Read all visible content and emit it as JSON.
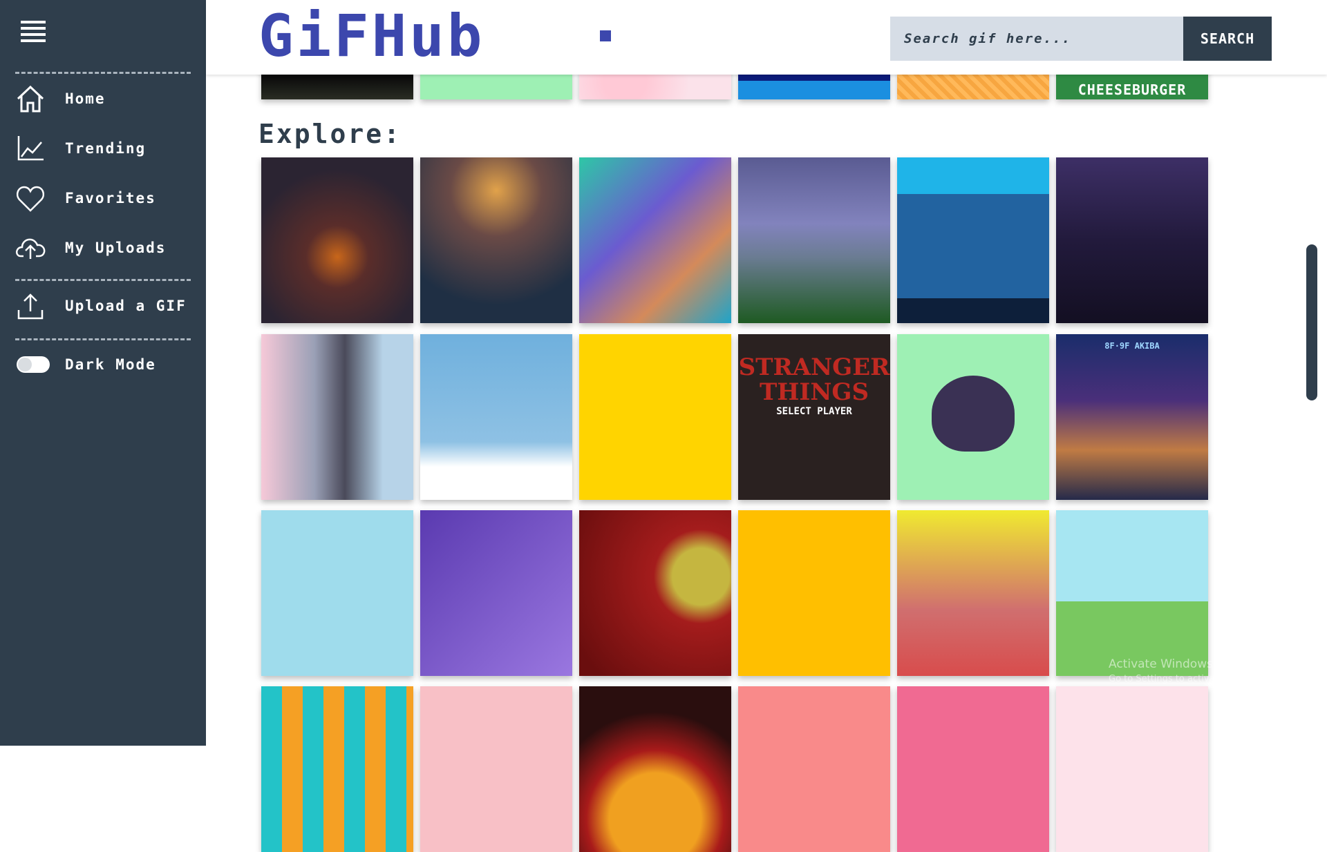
{
  "sidebar": {
    "items": [
      {
        "label": "Home",
        "icon": "home-icon"
      },
      {
        "label": "Trending",
        "icon": "trending-chart-icon"
      },
      {
        "label": "Favorites",
        "icon": "heart-icon"
      },
      {
        "label": "My Uploads",
        "icon": "cloud-upload-icon"
      },
      {
        "label": "Upload a GIF",
        "icon": "upload-arrow-icon"
      },
      {
        "label": "Dark Mode",
        "icon": "toggle-switch"
      }
    ],
    "dark_mode_enabled": false
  },
  "header": {
    "logo": "GiFHub",
    "search_placeholder": "Search gif here...",
    "search_button": "SEARCH"
  },
  "main": {
    "section_title": "Explore:",
    "top_row_caption": "CHEESEBURGER",
    "stranger_title_line1": "STRANGER",
    "stranger_title_line2": "THINGS",
    "stranger_sub": "SELECT PLAYER",
    "akiba_sign": "8F·9F AKIBA"
  },
  "os_watermark": {
    "title": "Activate Windows",
    "subtitle": "Go to Settings to activate Windows."
  },
  "colors": {
    "sidebar_bg": "#2f3e4c",
    "brand": "#3c47ad",
    "search_bg": "#d6dde6"
  }
}
